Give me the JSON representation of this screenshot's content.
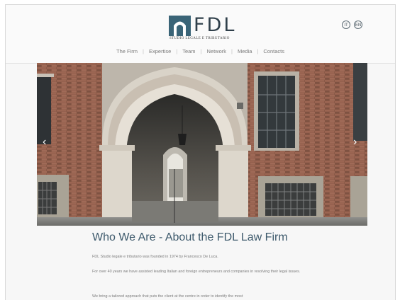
{
  "brand": {
    "letters": "FDL",
    "tagline": "STUDIO LEGALE E TRIBUTARIO",
    "colors": {
      "primary": "#2f3f4a",
      "accent": "#3e5a6c"
    }
  },
  "languages": [
    {
      "label": "IT",
      "icon": "italian-language-icon"
    },
    {
      "label": "EN",
      "icon": "english-language-icon"
    }
  ],
  "nav": {
    "items": [
      {
        "label": "The Firm"
      },
      {
        "label": "Expertise"
      },
      {
        "label": "Team"
      },
      {
        "label": "Network"
      },
      {
        "label": "Media"
      },
      {
        "label": "Contacts"
      }
    ],
    "separator": "|"
  },
  "slider": {
    "prev_icon": "‹",
    "next_icon": "›"
  },
  "content": {
    "title": "Who We Are - About the FDL Law Firm",
    "paragraphs": [
      "FDL Studio legale e tributario was founded in 1974 by Francesco De Luca.",
      "For over 40 years we have assisted leading Italian and foreign entrepreneurs and companies in resolving their legal issues.",
      "We bring a tailored approach that puts the client at the centre in order to identify the most"
    ]
  }
}
